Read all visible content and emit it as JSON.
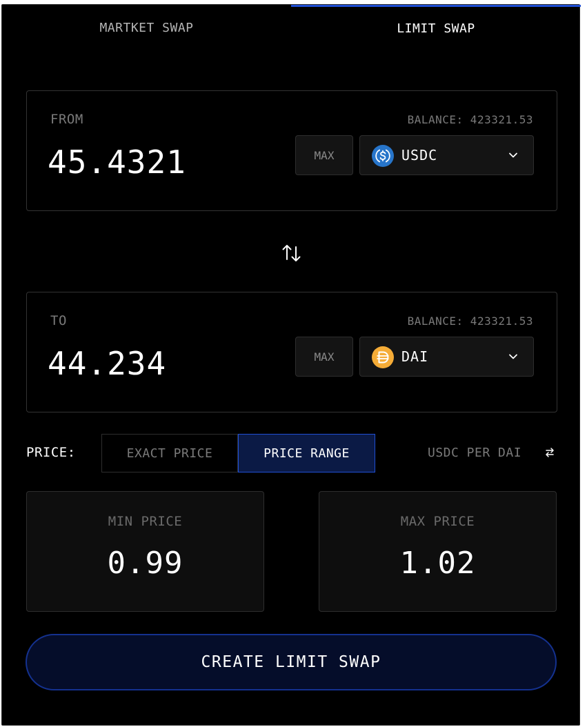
{
  "tabs": {
    "market": "MARTKET SWAP",
    "limit": "LIMIT SWAP",
    "active": "limit"
  },
  "from": {
    "label": "FROM",
    "balance": "BALANCE: 423321.53",
    "amount": "45.4321",
    "max_label": "MAX",
    "token": "USDC",
    "token_icon": "usdc-icon",
    "token_color": "#2775CA"
  },
  "to": {
    "label": "TO",
    "balance": "BALANCE: 423321.53",
    "amount": "44.234",
    "max_label": "MAX",
    "token": "DAI",
    "token_icon": "dai-icon",
    "token_color": "#F5AC37"
  },
  "price": {
    "label": "PRICE:",
    "exact_label": "EXACT PRICE",
    "range_label": "PRICE RANGE",
    "active_mode": "range",
    "unit": "USDC PER DAI",
    "min_label": "MIN PRICE",
    "min_value": "0.99",
    "max_label": "MAX PRICE",
    "max_value": "1.02"
  },
  "submit_label": "CREATE LIMIT SWAP",
  "colors": {
    "accent": "#1F4FD6",
    "background": "#000000"
  }
}
